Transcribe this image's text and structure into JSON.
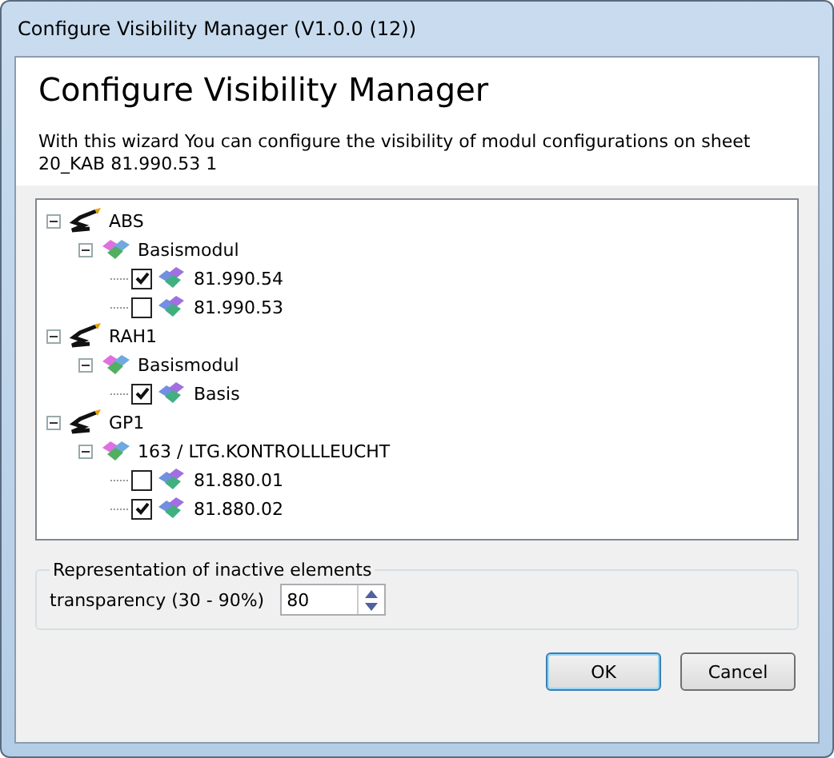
{
  "window": {
    "title": "Configure Visibility Manager  (V1.0.0 (12))"
  },
  "header": {
    "title": "Configure Visibility Manager",
    "description": "With this wizard You can configure the visibility of modul configurations on sheet 20_KAB 81.990.53 1"
  },
  "tree": [
    {
      "kind": "connector",
      "label": "ABS",
      "expanded": true,
      "children": [
        {
          "kind": "module",
          "label": "Basismodul",
          "expanded": true,
          "children": [
            {
              "kind": "variant",
              "label": "81.990.54",
              "checked": true
            },
            {
              "kind": "variant",
              "label": "81.990.53",
              "checked": false
            }
          ]
        }
      ]
    },
    {
      "kind": "connector",
      "label": "RAH1",
      "expanded": true,
      "children": [
        {
          "kind": "module",
          "label": "Basismodul",
          "expanded": true,
          "children": [
            {
              "kind": "variant",
              "label": "Basis",
              "checked": true
            }
          ]
        }
      ]
    },
    {
      "kind": "connector",
      "label": "GP1",
      "expanded": true,
      "children": [
        {
          "kind": "module",
          "label": "163 / LTG.KONTROLLLEUCHT",
          "expanded": true,
          "children": [
            {
              "kind": "variant",
              "label": "81.880.01",
              "checked": false
            },
            {
              "kind": "variant",
              "label": "81.880.02",
              "checked": true
            }
          ]
        }
      ]
    }
  ],
  "inactive": {
    "legend": "Representation of inactive elements",
    "label": "transparency (30 - 90%)",
    "value": "80"
  },
  "buttons": [
    "OK",
    "Cancel"
  ]
}
